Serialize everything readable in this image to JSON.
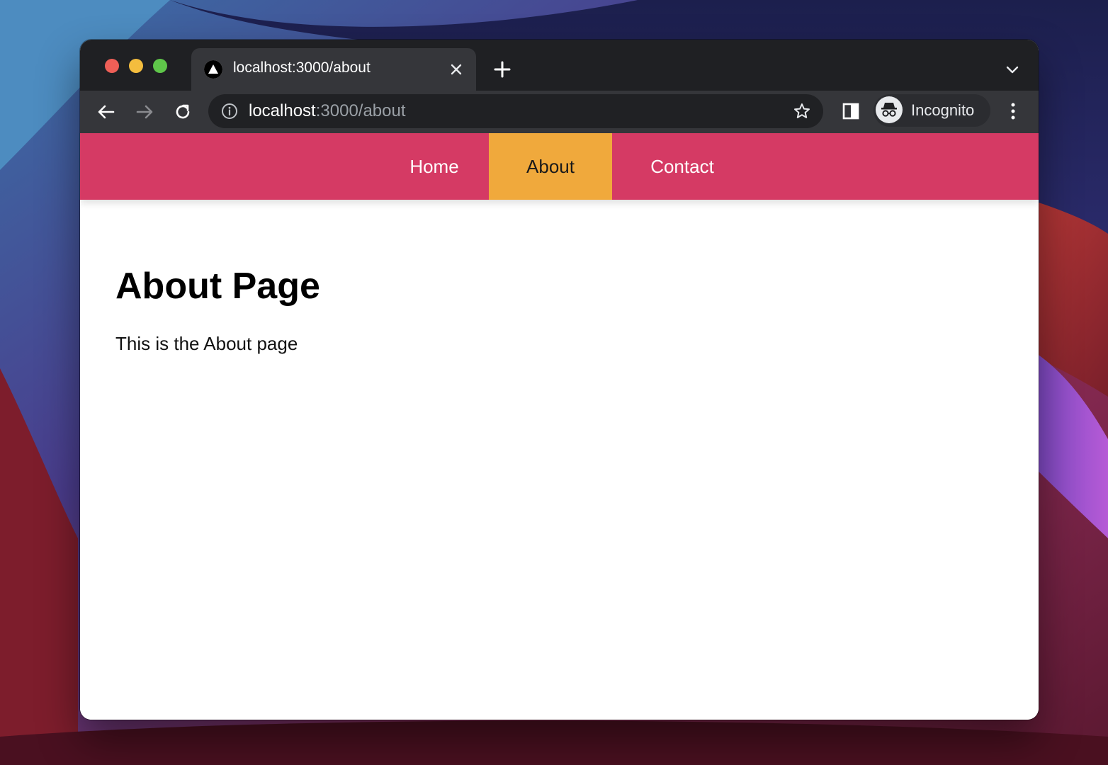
{
  "browser": {
    "tab": {
      "title": "localhost:3000/about"
    },
    "address_bar": {
      "host": "localhost",
      "path": ":3000/about"
    },
    "profile": {
      "label": "Incognito"
    },
    "icons": [
      "close-icon",
      "plus-icon",
      "chevron-down-icon",
      "back-arrow-icon",
      "forward-arrow-icon",
      "reload-icon",
      "info-icon",
      "star-icon",
      "side-panel-icon",
      "incognito-icon",
      "more-vert-icon"
    ]
  },
  "site": {
    "nav": [
      {
        "label": "Home",
        "active": false
      },
      {
        "label": "About",
        "active": true
      },
      {
        "label": "Contact",
        "active": false
      }
    ],
    "heading": "About Page",
    "body_text": "This is the About page"
  },
  "colors": {
    "nav_background": "#d53a64",
    "nav_active": "#f0a93c",
    "chrome_dark": "#1f2023",
    "chrome_toolbar": "#35363a"
  }
}
